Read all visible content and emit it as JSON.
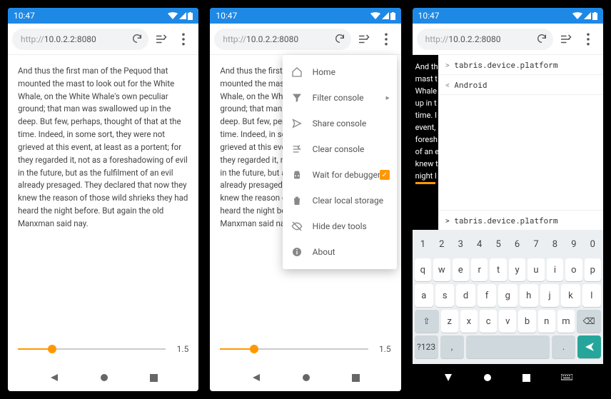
{
  "status": {
    "time": "10:47"
  },
  "address": {
    "proto": "http://",
    "host": "10.0.2.2:8080"
  },
  "paragraph": "And thus the first man of the Pequod that mounted the mast to look out for the White Whale, on the White Whale's own peculiar ground; that man was swallowed up in the deep. But few, perhaps, thought of that at the time. Indeed, in some sort, they were not grieved at this event, at least as a portent; for they regarded it, not as a foreshadowing of evil in the future, but as the fulfilment of an evil already presaged. They declared that now they knew the reason of those wild shrieks they had heard the night before. But again the old Manxman said nay.",
  "slider": {
    "value_label": "1.5",
    "fill_percent": 23
  },
  "menu": {
    "items": [
      {
        "label": "Home"
      },
      {
        "label": "Filter console",
        "chevron": true
      },
      {
        "label": "Share console"
      },
      {
        "label": "Clear console"
      },
      {
        "label": "Wait for debugger",
        "checked": true
      },
      {
        "label": "Clear local storage"
      },
      {
        "label": "Hide dev tools"
      },
      {
        "label": "About"
      }
    ]
  },
  "console": {
    "lines": [
      {
        "caret": ">",
        "text": "tabris.device.platform"
      },
      {
        "caret": "<",
        "text": "Android"
      }
    ],
    "input": {
      "caret": ">",
      "text": "tabris.device.platform"
    }
  },
  "truncated_lines": [
    "And th",
    "mast t",
    "Whale",
    "up in t",
    "time. I",
    "event,",
    "foresh",
    "of an e",
    "knew t",
    "night l"
  ],
  "keyboard": {
    "row_num": [
      "1",
      "2",
      "3",
      "4",
      "5",
      "6",
      "7",
      "8",
      "9",
      "0"
    ],
    "row1": [
      "q",
      "w",
      "e",
      "r",
      "t",
      "y",
      "u",
      "i",
      "o",
      "p"
    ],
    "row2": [
      "a",
      "s",
      "d",
      "f",
      "g",
      "h",
      "j",
      "k",
      "l"
    ],
    "row3": [
      "z",
      "x",
      "c",
      "v",
      "b",
      "n",
      "m"
    ],
    "func": {
      "shift": "⇧",
      "bksp": "⌫",
      "sym": "?123",
      "comma": ",",
      "dot": "."
    }
  }
}
